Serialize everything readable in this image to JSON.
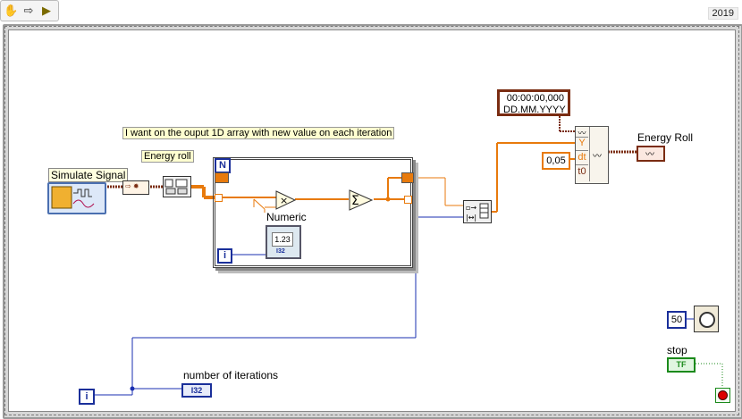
{
  "toolbar": {
    "version": "2019",
    "icons": [
      "hand-icon",
      "arrow-icon",
      "run-icon"
    ]
  },
  "labels": {
    "simulate_signal": "Simulate Signal",
    "comment": "I want on the ouput 1D array with new value on each iteration",
    "energy_roll_label": "Energy roll",
    "numeric": "Numeric",
    "numeric_display": "1.23",
    "i32_tag": "I32",
    "energy_roll_out": "Energy  Roll",
    "number_of_iterations": "number of iterations",
    "stop": "stop",
    "tf": "TF"
  },
  "loop": {
    "count_terminal": "N",
    "iteration_terminal": "i"
  },
  "timestamp": {
    "line1": "00:00:00,000",
    "line2": "DD.MM.YYYY"
  },
  "waveform_build": {
    "y": "Y",
    "dt": "dt",
    "t0": "t0",
    "dt_value": "0,05"
  },
  "wait": {
    "value": "50"
  },
  "outer_loop": {
    "iteration_terminal": "i"
  },
  "colors": {
    "wire_orange": "#e87a0c",
    "wire_blue": "#1a2fb0",
    "wire_brown": "#7a2c12",
    "bool_green": "#1b8a1b"
  }
}
